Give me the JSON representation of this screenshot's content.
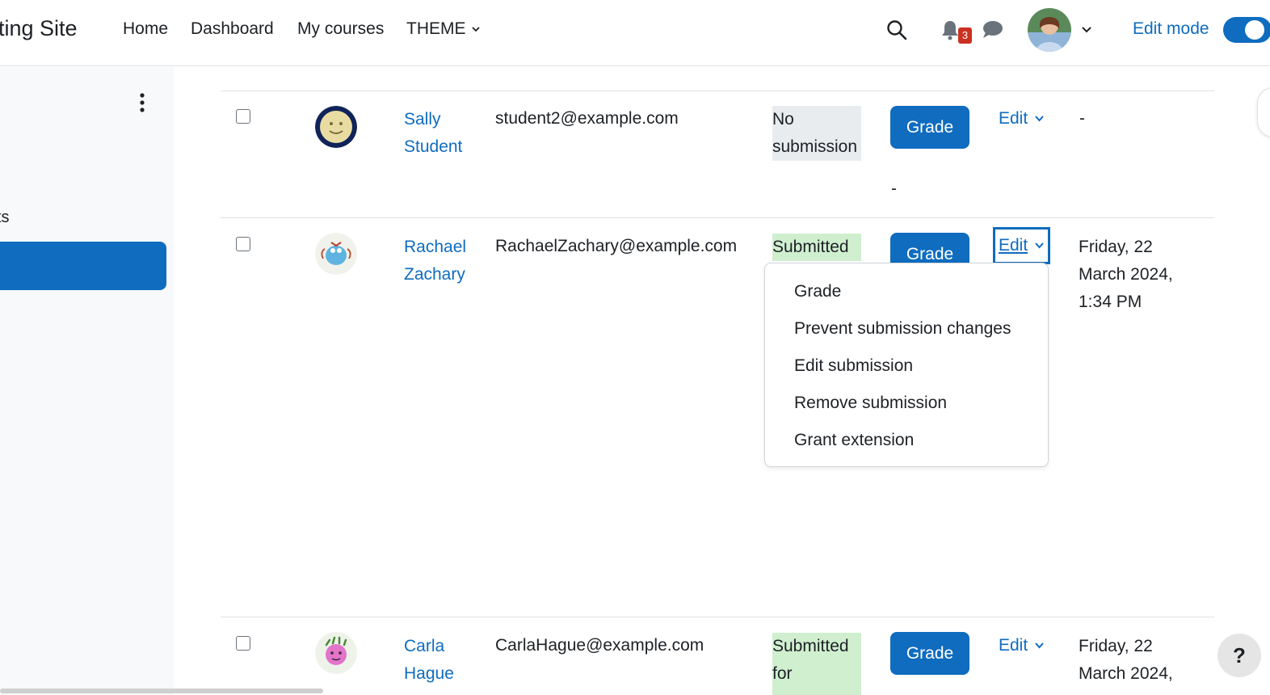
{
  "navbar": {
    "site_name": "ting Site",
    "links": [
      "Home",
      "Dashboard",
      "My courses",
      "THEME"
    ],
    "notification_count": "3",
    "edit_mode_label": "Edit mode"
  },
  "drawer": {
    "partial_text": "ts"
  },
  "table": {
    "rows": [
      {
        "first": "Sally",
        "last": "Student",
        "email": "student2@example.com",
        "status_1": "No",
        "status_2": "submission",
        "grade_label": "Grade",
        "grade_value": "-",
        "edit_label": "Edit",
        "last_modified": "-"
      },
      {
        "first": "Rachael",
        "last": "Zachary",
        "email": "RachaelZachary@example.com",
        "status_1": "Submitted",
        "status_2": "",
        "grade_label": "Grade",
        "edit_label": "Edit",
        "date_1": "Friday, 22",
        "date_2": "March 2024,",
        "date_3": "1:34 PM"
      },
      {
        "first": "Carla",
        "last": "Hague",
        "email": "CarlaHague@example.com",
        "status_1": "Submitted",
        "status_2": "for",
        "grade_label": "Grade",
        "edit_label": "Edit",
        "date_1": "Friday, 22",
        "date_2": "March 2024,"
      }
    ]
  },
  "edit_menu": {
    "items": [
      "Grade",
      "Prevent submission changes",
      "Edit submission",
      "Remove submission",
      "Grant extension"
    ]
  },
  "help": {
    "label": "?"
  },
  "colors": {
    "primary": "#0f6cbf",
    "submitted_bg": "#cfefcf",
    "nosub_bg": "#e9ecef",
    "badge": "#ca3120"
  }
}
